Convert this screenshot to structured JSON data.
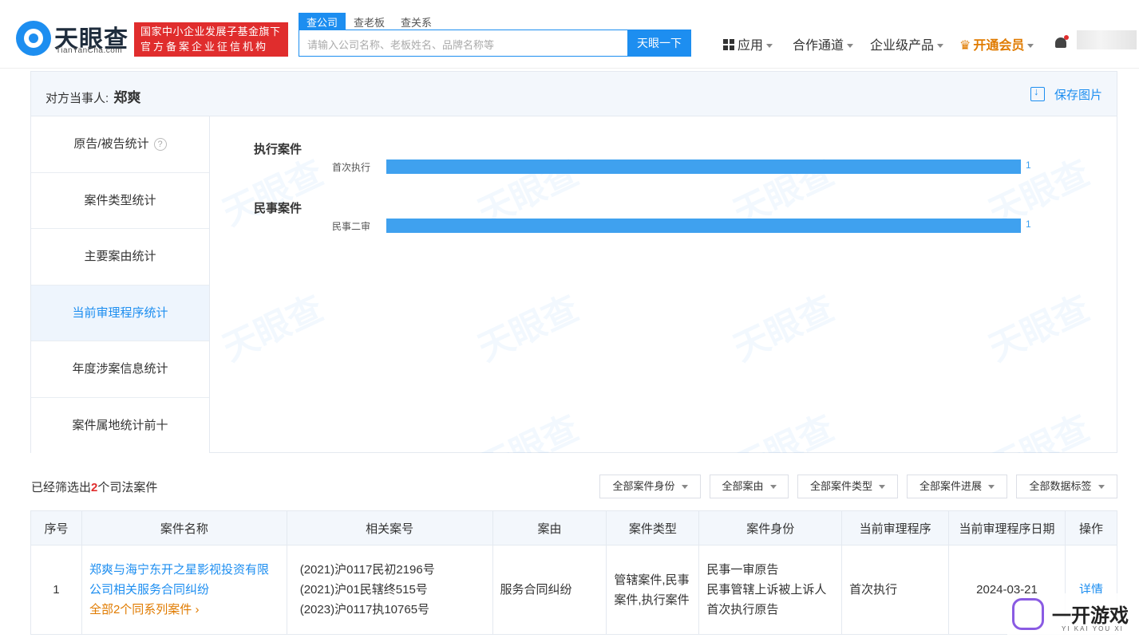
{
  "header": {
    "logo_text": "天眼查",
    "logo_sub": "TianYanCha.com",
    "badge_line1": "国家中小企业发展子基金旗下",
    "badge_line2": "官方备案企业征信机构",
    "search_tabs": [
      "查公司",
      "查老板",
      "查关系"
    ],
    "search_placeholder": "请输入公司名称、老板姓名、品牌名称等",
    "search_button": "天眼一下",
    "nav": {
      "apps": "应用",
      "cooperation": "合作通道",
      "enterprise": "企业级产品",
      "vip": "开通会员"
    }
  },
  "panel": {
    "title_prefix": "对方当事人:",
    "party_name": "郑爽",
    "save_image": "保存图片",
    "left_nav": [
      "原告/被告统计",
      "案件类型统计",
      "主要案由统计",
      "当前审理程序统计",
      "年度涉案信息统计",
      "案件属地统计前十"
    ],
    "active_nav_index": 3,
    "help_icon": "?"
  },
  "chart_data": {
    "type": "bar",
    "orientation": "horizontal",
    "groups": [
      {
        "title": "执行案件",
        "categories": [
          "首次执行"
        ],
        "values": [
          1
        ]
      },
      {
        "title": "民事案件",
        "categories": [
          "民事二审"
        ],
        "values": [
          1
        ]
      }
    ],
    "xlim": [
      0,
      1
    ],
    "grid": false,
    "bar_color": "#3fa1ef"
  },
  "filters": {
    "summary_prefix": "已经筛选出",
    "count": "2",
    "summary_suffix": "个司法案件",
    "buttons": [
      "全部案件身份",
      "全部案由",
      "全部案件类型",
      "全部案件进展",
      "全部数据标签"
    ]
  },
  "table": {
    "headers": [
      "序号",
      "案件名称",
      "相关案号",
      "案由",
      "案件类型",
      "案件身份",
      "当前审理程序",
      "当前审理程序日期",
      "操作"
    ],
    "rows": [
      {
        "index": "1",
        "case_name": "郑爽与海宁东开之星影视投资有限公司相关服务合同纠纷",
        "series": "全部2个同系列案件 ›",
        "case_numbers": [
          "(2021)沪0117民初2196号",
          "(2021)沪01民辖终515号",
          "(2023)沪0117执10765号"
        ],
        "cause": "服务合同纠纷",
        "case_type": "管辖案件,民事案件,执行案件",
        "identities": [
          "民事一审原告",
          "民事管辖上诉被上诉人",
          "首次执行原告"
        ],
        "procedure": "首次执行",
        "date": "2024-03-21",
        "action": "详情"
      }
    ]
  },
  "watermark": {
    "brand": "一开游戏",
    "brand_sub": "YI KAI YOU XI",
    "site_mark": "天眼查"
  },
  "colors": {
    "accent": "#1d8ef0",
    "badge_red": "#e02d2d",
    "vip_orange": "#e07b00"
  }
}
